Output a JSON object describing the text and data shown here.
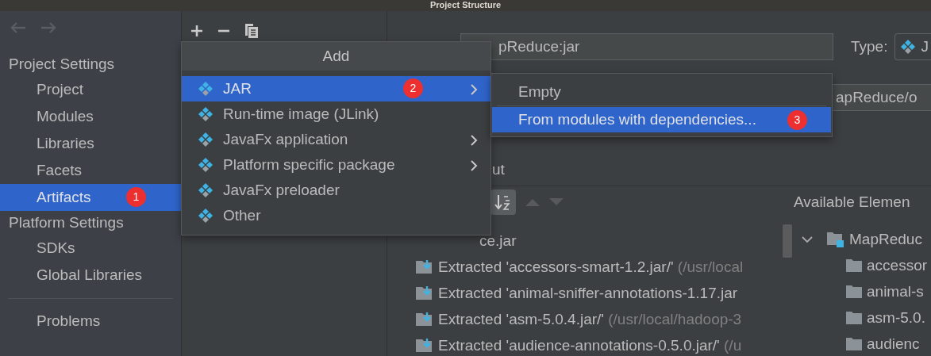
{
  "window": {
    "title": "Project Structure"
  },
  "nav": {
    "back": {
      "disabled": true
    },
    "forward": {
      "disabled": true
    }
  },
  "sidebar": {
    "sections": [
      {
        "heading": "Project Settings",
        "items": [
          {
            "label": "Project",
            "selected": false
          },
          {
            "label": "Modules",
            "selected": false
          },
          {
            "label": "Libraries",
            "selected": false
          },
          {
            "label": "Facets",
            "selected": false
          },
          {
            "label": "Artifacts",
            "selected": true,
            "badge": "1"
          }
        ]
      },
      {
        "heading": "Platform Settings",
        "items": [
          {
            "label": "SDKs",
            "selected": false
          },
          {
            "label": "Global Libraries",
            "selected": false
          }
        ]
      }
    ],
    "footer_items": [
      {
        "label": "Problems",
        "selected": false
      }
    ]
  },
  "artifact": {
    "name_value": "pReduce:jar",
    "type_label": "Type:",
    "type_value": "J",
    "output_value": "apReduce/o",
    "layout_tab": "ut",
    "tree_root": "ce.jar",
    "rows": [
      {
        "name": "Extracted 'accessors-smart-1.2.jar/'",
        "path": "(/usr/local"
      },
      {
        "name": "Extracted 'animal-sniffer-annotations-1.17.jar"
      },
      {
        "name": "Extracted 'asm-5.0.4.jar/'",
        "path": "(/usr/local/hadoop-3"
      },
      {
        "name": "Extracted 'audience-annotations-0.5.0.jar/'",
        "path": "(/u"
      }
    ],
    "available": {
      "title": "Available Elemen",
      "items": [
        {
          "label": "MapReduc",
          "kind": "module",
          "expanded": true
        },
        {
          "label": "accessor",
          "kind": "folder"
        },
        {
          "label": "animal-s",
          "kind": "folder"
        },
        {
          "label": "asm-5.0.",
          "kind": "folder"
        },
        {
          "label": "audienc",
          "kind": "folder"
        }
      ]
    }
  },
  "add_menu": {
    "title": "Add",
    "items": [
      {
        "label": "JAR",
        "selected": true,
        "submenu": true,
        "badge": "2"
      },
      {
        "label": "Run-time image (JLink)",
        "selected": false,
        "submenu": false
      },
      {
        "label": "JavaFx application",
        "selected": false,
        "submenu": true
      },
      {
        "label": "Platform specific package",
        "selected": false,
        "submenu": true
      },
      {
        "label": "JavaFx preloader",
        "selected": false,
        "submenu": false
      },
      {
        "label": "Other",
        "selected": false,
        "submenu": false
      }
    ]
  },
  "submenu": {
    "items": [
      {
        "label": "Empty",
        "selected": false
      },
      {
        "label": "From modules with dependencies...",
        "selected": true,
        "badge": "3"
      }
    ]
  }
}
